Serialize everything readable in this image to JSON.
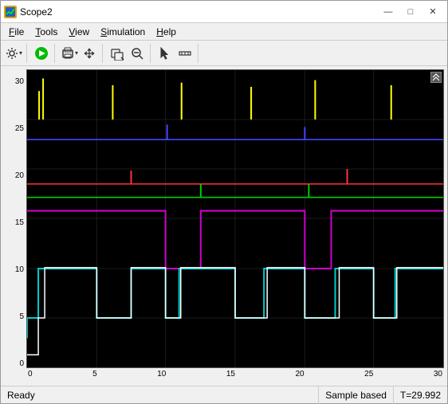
{
  "window": {
    "title": "Scope2",
    "icon_label": "S"
  },
  "title_controls": {
    "minimize": "—",
    "maximize": "□",
    "close": "✕"
  },
  "menu": {
    "items": [
      {
        "label": "File",
        "underline": "F"
      },
      {
        "label": "Tools",
        "underline": "T"
      },
      {
        "label": "View",
        "underline": "V"
      },
      {
        "label": "Simulation",
        "underline": "S"
      },
      {
        "label": "Help",
        "underline": "H"
      }
    ]
  },
  "plot": {
    "y_labels": [
      "30",
      "25",
      "20",
      "15",
      "10",
      "5",
      "0"
    ],
    "x_labels": [
      "0",
      "5",
      "10",
      "15",
      "20",
      "25",
      "30"
    ]
  },
  "status": {
    "ready": "Ready",
    "sample_based": "Sample based",
    "time": "T=29.992"
  }
}
